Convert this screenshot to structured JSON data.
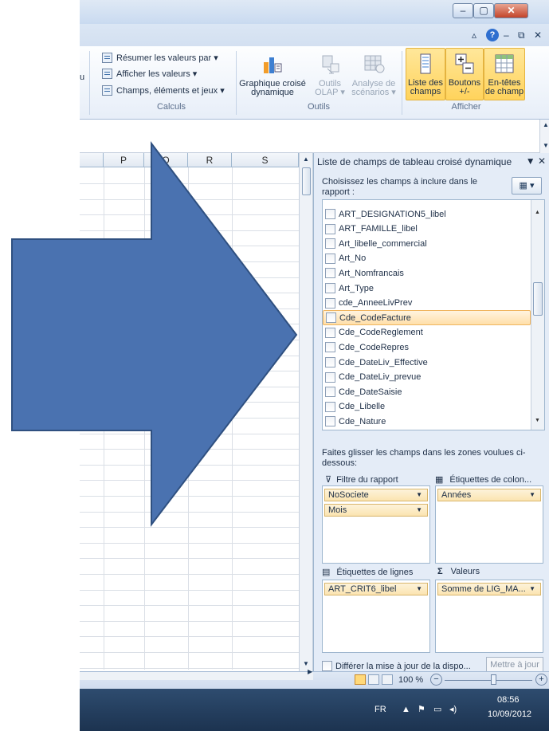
{
  "window": {
    "minimize": "–",
    "maximize": "▢",
    "close": "✕"
  },
  "ribbon": {
    "calculs": {
      "items": [
        "Résumer les valeurs par ▾",
        "Afficher les valeurs ▾",
        "Champs, éléments et jeux ▾"
      ],
      "label": "Calculs"
    },
    "cut_letter": "u",
    "outils": {
      "pivotchart_l1": "Graphique croisé",
      "pivotchart_l2": "dynamique",
      "olap_l1": "Outils",
      "olap_l2": "OLAP ▾",
      "scenario_l1": "Analyse de",
      "scenario_l2": "scénarios ▾",
      "label": "Outils"
    },
    "afficher": {
      "fieldlist_l1": "Liste des",
      "fieldlist_l2": "champs",
      "buttons_l1": "Boutons",
      "buttons_l2": "+/-",
      "headers_l1": "En-têtes",
      "headers_l2": "de champ",
      "label": "Afficher"
    }
  },
  "sheet": {
    "columns": [
      "P",
      "Q",
      "R",
      "S"
    ]
  },
  "pane": {
    "title": "Liste de champs de tableau croisé dynamique",
    "controls": "▼ ✕",
    "instruction": "Choisissez les champs à inclure dans le rapport :",
    "fields": [
      "ART_DESIGNATION5_libel",
      "ART_FAMILLE_libel",
      "Art_libelle_commercial",
      "Art_No",
      "Art_Nomfrancais",
      "Art_Type",
      "cde_AnneeLivPrev",
      "Cde_CodeFacture",
      "Cde_CodeReglement",
      "Cde_CodeRepres",
      "Cde_DateLiv_Effective",
      "Cde_DateLiv_prevue",
      "Cde_DateSaisie",
      "Cde_Libelle",
      "Cde_Nature"
    ],
    "selected_field_index": 7,
    "drag_instruction": "Faites glisser les champs dans les zones voulues ci-dessous:",
    "zones": {
      "filter_label": "Filtre du rapport",
      "filter_items": [
        "NoSociete",
        "Mois"
      ],
      "columns_label": "Étiquettes de colon...",
      "columns_items": [
        "Années"
      ],
      "rows_label": "Étiquettes de lignes",
      "rows_items": [
        "ART_CRIT6_libel"
      ],
      "values_label": "Valeurs",
      "values_items": [
        "Somme de LIG_MA..."
      ]
    },
    "defer_label": "Différer la mise à jour de la dispo...",
    "update_button": "Mettre à jour"
  },
  "status": {
    "zoom": "100 %"
  },
  "taskbar": {
    "lang": "FR",
    "time": "08:56",
    "date": "10/09/2012"
  },
  "colors": {
    "arrow_fill": "#4a72b0",
    "arrow_stroke": "#2f5080",
    "selected_field": "#ffdfa9"
  }
}
